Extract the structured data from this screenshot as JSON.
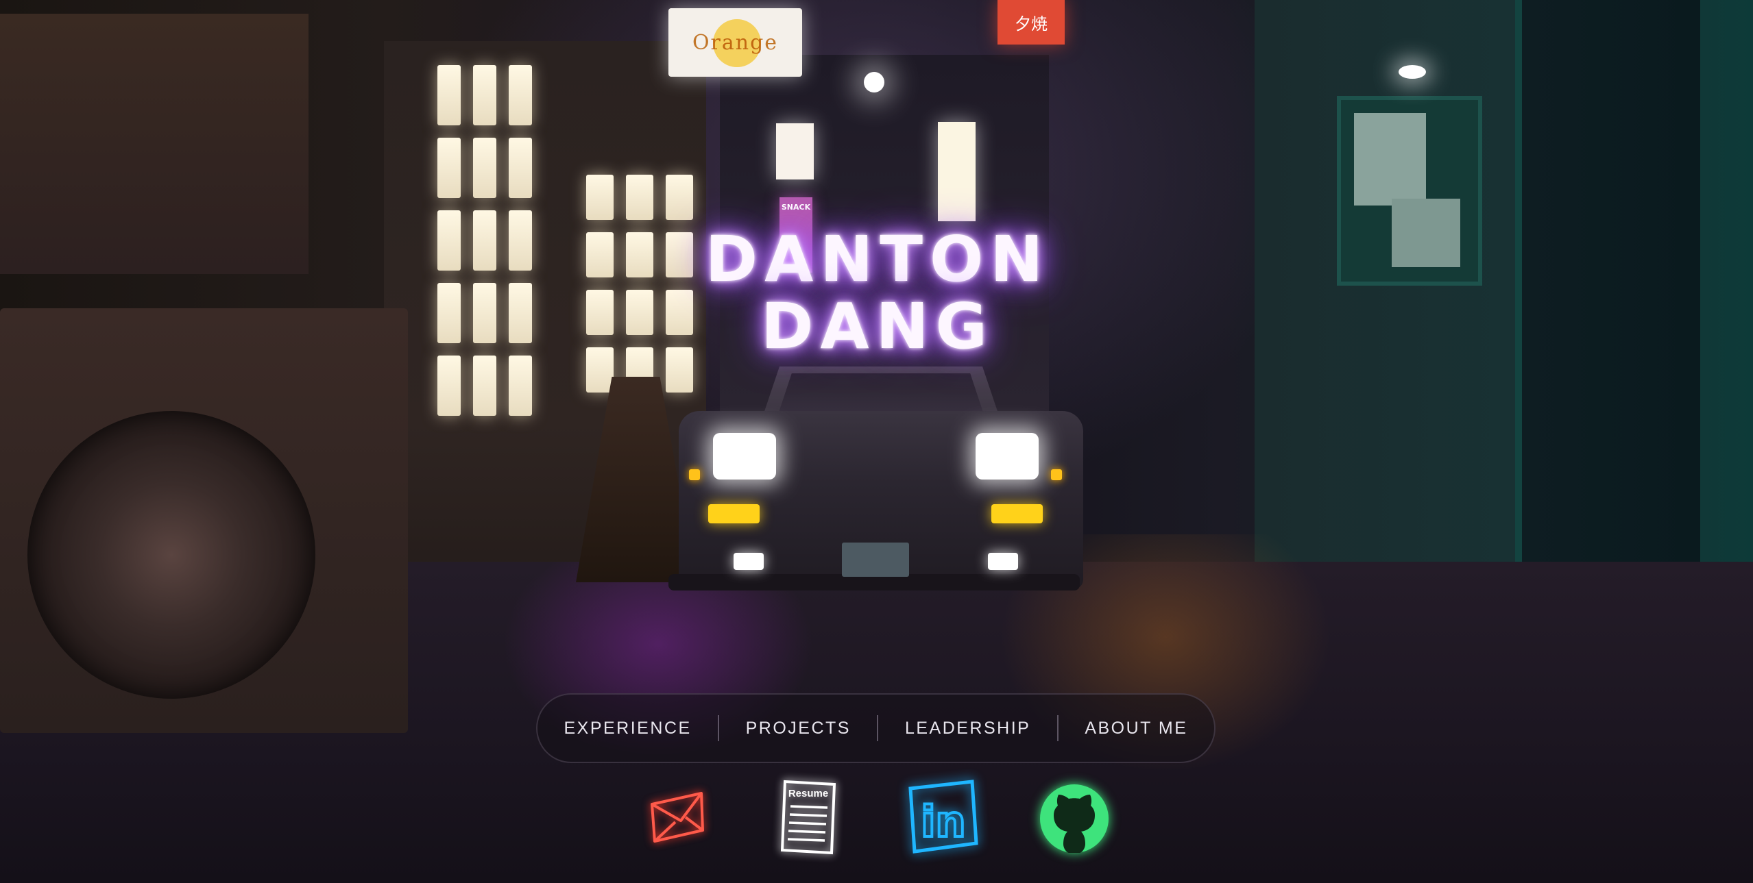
{
  "hero": {
    "title_line1": "DANTON",
    "title_line2": "DANG"
  },
  "scene_signs": {
    "orange_sign_text": "Orange",
    "snack_sign_text": "SNACK",
    "red_sign_text": "夕焼"
  },
  "nav": {
    "items": [
      {
        "label": "EXPERIENCE"
      },
      {
        "label": "PROJECTS"
      },
      {
        "label": "LEADERSHIP"
      },
      {
        "label": "ABOUT ME"
      }
    ]
  },
  "social": {
    "email_icon": "envelope-icon",
    "resume_icon": "resume-document-icon",
    "resume_label": "Resume",
    "linkedin_icon": "linkedin-icon",
    "linkedin_label": "in",
    "github_icon": "github-icon"
  },
  "colors": {
    "title_glow": "#b06bff",
    "email_neon": "#ff5a4a",
    "resume_neon": "#ffffff",
    "linkedin_neon": "#1fb6ff",
    "github_neon": "#3ee37c",
    "headlight": "#ffffff",
    "foglight": "#ffd21a"
  }
}
